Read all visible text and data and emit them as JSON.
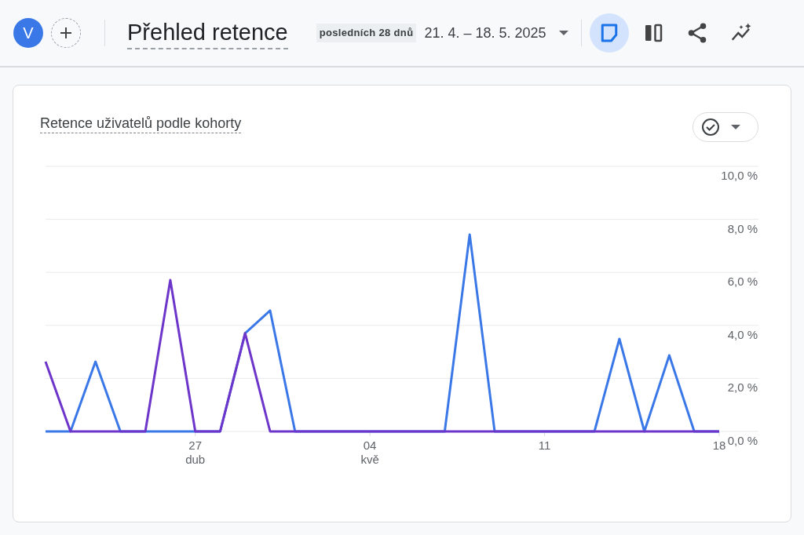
{
  "header": {
    "avatar_letter": "V",
    "title": "Přehled retence",
    "period": "posledních 28 dnů",
    "date_range": "21. 4. – 18. 5. 2025",
    "tools": [
      {
        "kind": "note",
        "selected": true
      },
      {
        "kind": "compare",
        "selected": false
      },
      {
        "kind": "share",
        "selected": false
      },
      {
        "kind": "insights",
        "selected": false
      }
    ]
  },
  "card": {
    "title": "Retence uživatelů podle kohorty",
    "chart_data": {
      "type": "line",
      "grid": true,
      "categories": [
        null,
        null,
        null,
        null,
        null,
        null,
        "27\ndub",
        null,
        null,
        null,
        null,
        null,
        null,
        "04\nkvě",
        null,
        null,
        null,
        null,
        null,
        null,
        "11",
        null,
        null,
        null,
        null,
        null,
        null,
        "18"
      ],
      "ylim": [
        0,
        10
      ],
      "yticks": [
        {
          "value": 0,
          "label": "0,0 %"
        },
        {
          "value": 2,
          "label": "2,0 %"
        },
        {
          "value": 4,
          "label": "4,0 %"
        },
        {
          "value": 6,
          "label": "6,0 %"
        },
        {
          "value": 8,
          "label": "8,0 %"
        },
        {
          "value": 10,
          "label": "10,0 %"
        }
      ],
      "series": [
        {
          "color": "#3b78e7",
          "values": [
            0,
            0,
            2.63,
            0,
            0,
            0,
            0,
            0,
            3.7,
            4.56,
            0,
            0,
            0,
            0,
            0,
            0,
            0,
            7.43,
            0,
            0,
            0,
            0,
            0,
            3.49,
            0,
            2.87,
            0,
            0
          ]
        },
        {
          "color": "#6d35c9",
          "values": [
            2.63,
            0,
            0,
            0,
            0,
            5.71,
            0,
            0,
            3.7,
            0,
            0,
            0,
            0,
            0,
            0,
            0,
            0,
            0,
            0,
            0,
            0,
            0,
            0,
            0,
            0,
            0,
            0,
            0
          ]
        }
      ]
    }
  }
}
